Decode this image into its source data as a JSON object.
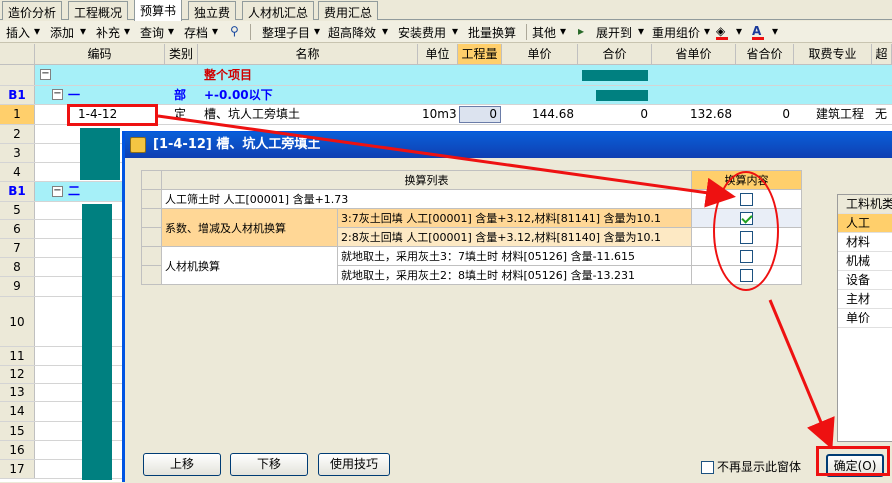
{
  "tabs": [
    "造价分析",
    "工程概况",
    "预算书",
    "独立费",
    "人材机汇总",
    "费用汇总"
  ],
  "active_tab": "预算书",
  "toolbar": [
    "插入",
    "添加",
    "补充",
    "查询",
    "存档",
    "整理子目",
    "超高降效",
    "安装费用",
    "批量换算",
    "其他",
    "展开到",
    "重用组价"
  ],
  "grid": {
    "headers": [
      "编码",
      "类别",
      "名称",
      "单位",
      "工程量",
      "单价",
      "合价",
      "省单价",
      "省合价",
      "取费专业",
      "超高"
    ],
    "rows": [
      {
        "num": "",
        "code": "",
        "type": "",
        "name": "整个项目",
        "kind": "project"
      },
      {
        "num": "B1",
        "code": "一",
        "type": "部",
        "name": "+-0.00以下",
        "kind": "section"
      },
      {
        "num": "1",
        "code": "1-4-12",
        "type": "定",
        "name": "槽、坑人工旁填土",
        "unit": "10m3",
        "qty": "0",
        "price": "144.68",
        "total": "0",
        "sprice": "132.68",
        "stotal": "0",
        "specialty": "建筑工程",
        "extra": "无",
        "kind": "item"
      },
      {
        "num": "2"
      },
      {
        "num": "3"
      },
      {
        "num": "4"
      },
      {
        "num": "B1",
        "code": "二",
        "kind": "section2"
      },
      {
        "num": "5"
      },
      {
        "num": "6"
      },
      {
        "num": "7"
      },
      {
        "num": "8"
      },
      {
        "num": "9"
      },
      {
        "num": "10"
      },
      {
        "num": "11"
      },
      {
        "num": "12"
      },
      {
        "num": "13"
      },
      {
        "num": "14"
      },
      {
        "num": "15"
      },
      {
        "num": "16"
      },
      {
        "num": "17"
      }
    ]
  },
  "dialog": {
    "title": "[1-4-12]  槽、坑人工旁填土",
    "col_list": "换算列表",
    "col_content": "换算内容",
    "rows": [
      {
        "group": "人工筛土时 人工[00001] 含量+1.73",
        "text": "",
        "checked": false
      },
      {
        "group": "系数、增减及人材机换算",
        "text": "3:7灰土回填 人工[00001] 含量+3.12,材料[81141] 含量为10.1",
        "checked": true
      },
      {
        "group": "",
        "text": "2:8灰土回填 人工[00001] 含量+3.12,材料[81140] 含量为10.1",
        "checked": false
      },
      {
        "group": "人材机换算",
        "text": "就地取土，采用灰土3：7填土时 材料[05126] 含量-11.615",
        "checked": false
      },
      {
        "group": "",
        "text": "就地取土，采用灰土2：8填土时 材料[05126] 含量-13.231",
        "checked": false
      }
    ],
    "side_title": "工料机类",
    "side_items": [
      "人工",
      "材料",
      "机械",
      "设备",
      "主材",
      "单价"
    ],
    "btn_up": "上移",
    "btn_down": "下移",
    "btn_tips": "使用技巧",
    "no_show": "不再显示此窗体",
    "ok": "确定(O)"
  }
}
